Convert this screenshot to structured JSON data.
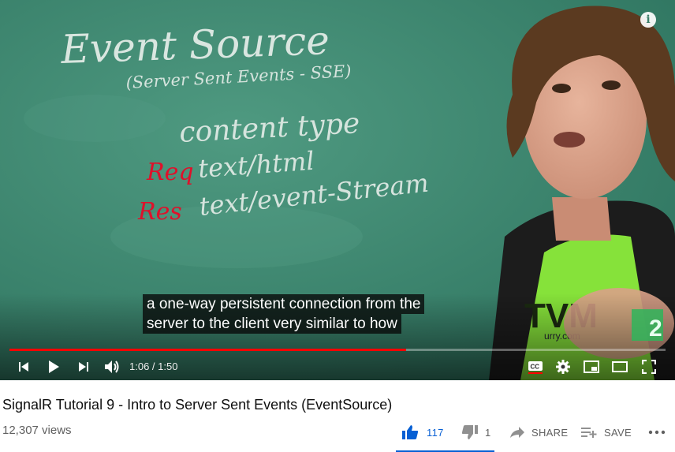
{
  "video": {
    "board_lines": [
      "Event Source",
      "(Server Sent Events - SSE)",
      "content type",
      "Req",
      "text/html",
      "Res",
      "text/event-Stream"
    ],
    "caption_lines": [
      "a one-way persistent connection from the",
      "server to the client very similar to how"
    ],
    "progress_fraction": 0.605,
    "time_display": "1:06 / 1:50",
    "colors": {
      "progress": "#ff0000",
      "board": "#3f8a72",
      "chalk_red": "#e0102a"
    }
  },
  "controls": {
    "left": [
      "previous-icon",
      "play-icon",
      "next-icon",
      "volume-icon"
    ],
    "right": [
      "captions-icon",
      "settings-icon",
      "miniplayer-icon",
      "theater-icon",
      "fullscreen-icon"
    ]
  },
  "info": {
    "title": "SignalR Tutorial 9 - Intro to Server Sent Events (EventSource)",
    "views": "12,307 views"
  },
  "actions": {
    "likes": "117",
    "dislikes": "1",
    "share": "SHARE",
    "save": "SAVE"
  },
  "accent": "#065fd4"
}
